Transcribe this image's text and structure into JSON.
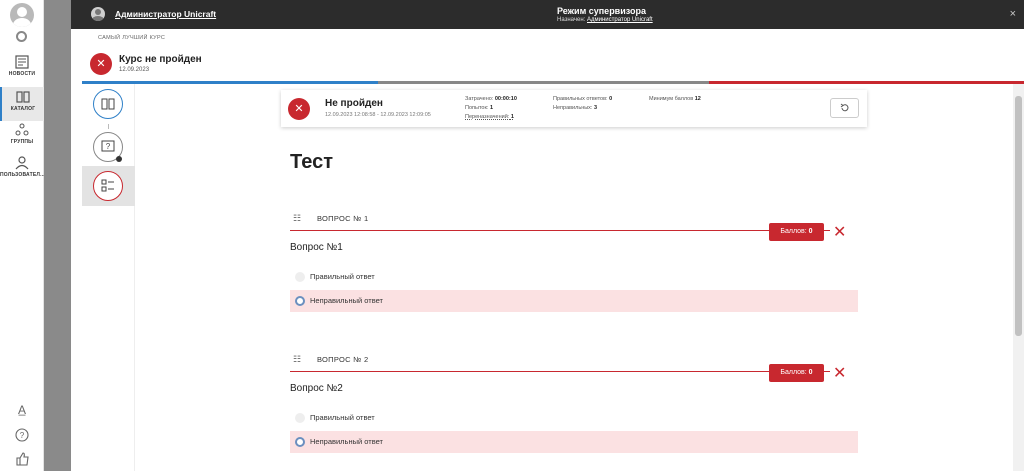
{
  "sidebar": {
    "items": [
      {
        "label": "НОВОСТИ",
        "icon": "news-icon"
      },
      {
        "label": "КАТАЛОГ",
        "icon": "catalog-icon"
      },
      {
        "label": "ГРУППЫ",
        "icon": "groups-icon"
      },
      {
        "label": "ПОЛЬЗОВАТЕЛ...",
        "icon": "users-icon"
      }
    ],
    "bottom_icons": [
      "translate-icon",
      "help-icon",
      "like-icon"
    ]
  },
  "topbar": {
    "user": "Администратор Unicraft",
    "mode_title": "Режим супервизора",
    "assigned_prefix": "Назначен:",
    "assigned_user": "Администратор Unicraft",
    "close": "×"
  },
  "course": {
    "breadcrumb": "САМЫЙ ЛУЧШИЙ КУРС",
    "title": "Курс не пройден",
    "date": "12.09.2023"
  },
  "result": {
    "status": "Не пройден",
    "range": "12.09.2023 12:08:58 - 12.09.2023 12:09:05",
    "spent_label": "Затрачено:",
    "spent_value": "00:00:10",
    "attempts_label": "Попыток:",
    "attempts_value": "1",
    "reassign_label": "Переназначений:",
    "reassign_value": "1",
    "correct_label": "Правильных ответов:",
    "correct_value": "0",
    "wrong_label": "Неправильных:",
    "wrong_value": "3",
    "min_label": "Минимум баллов",
    "min_value": "12"
  },
  "test": {
    "title": "Тест",
    "score_label": "Баллов:",
    "questions": [
      {
        "number": "ВОПРОС № 1",
        "text": "Вопрос №1",
        "score": "0",
        "options": [
          {
            "text": "Правильный ответ"
          },
          {
            "text": "Неправильный ответ"
          }
        ]
      },
      {
        "number": "ВОПРОС № 2",
        "text": "Вопрос №2",
        "score": "0",
        "options": [
          {
            "text": "Правильный ответ"
          },
          {
            "text": "Неправильный ответ"
          }
        ]
      }
    ]
  },
  "colors": {
    "accent_red": "#c8282f",
    "accent_blue": "#2f80c8",
    "topbar": "#2c2c2c"
  }
}
